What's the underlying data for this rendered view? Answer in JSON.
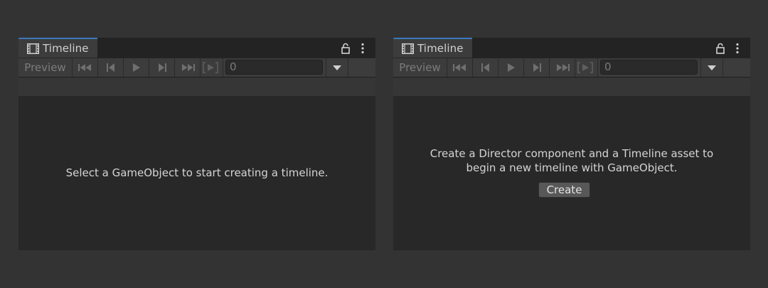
{
  "panels": [
    {
      "tab": {
        "label": "Timeline",
        "icon": "film-strip-icon"
      },
      "toolbar": {
        "preview_label": "Preview",
        "icons": [
          "go-to-start-icon",
          "previous-frame-icon",
          "play-icon",
          "next-frame-icon",
          "go-to-end-icon",
          "play-range-icon",
          "dropdown-arrow-icon"
        ],
        "time_value": "0"
      },
      "message": "Select a GameObject to start creating a timeline."
    },
    {
      "tab": {
        "label": "Timeline",
        "icon": "film-strip-icon"
      },
      "toolbar": {
        "preview_label": "Preview",
        "icons": [
          "go-to-start-icon",
          "previous-frame-icon",
          "play-icon",
          "next-frame-icon",
          "go-to-end-icon",
          "play-range-icon",
          "dropdown-arrow-icon"
        ],
        "time_value": "0"
      },
      "message_line1": "Create a Director component and a Timeline asset to",
      "message_line2": "begin a new timeline with GameObject.",
      "create_label": "Create"
    }
  ],
  "colors": {
    "background": "#333333",
    "panel": "#282828",
    "tab_accent": "#3a79bb",
    "toolbar": "#3c3c3c"
  }
}
